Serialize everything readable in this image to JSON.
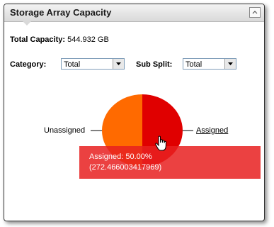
{
  "panel": {
    "title": "Storage Array Capacity",
    "total_label": "Total Capacity:",
    "total_value": "544.932 GB"
  },
  "filters": {
    "category_label": "Category:",
    "category_value": "Total",
    "subsplit_label": "Sub Split:",
    "subsplit_value": "Total"
  },
  "chart_data": {
    "type": "pie",
    "slices": [
      {
        "label": "Unassigned",
        "value": 272.466,
        "color": "#ff6a00"
      },
      {
        "label": "Assigned",
        "value": 272.466003417969,
        "color": "#e00000"
      }
    ]
  },
  "tooltip": {
    "line1": "Assigned: 50.00%",
    "line2": "(272.466003417969)"
  },
  "icons": {
    "collapse": "chevron-up-icon",
    "cursor": "hand-pointer-icon"
  }
}
